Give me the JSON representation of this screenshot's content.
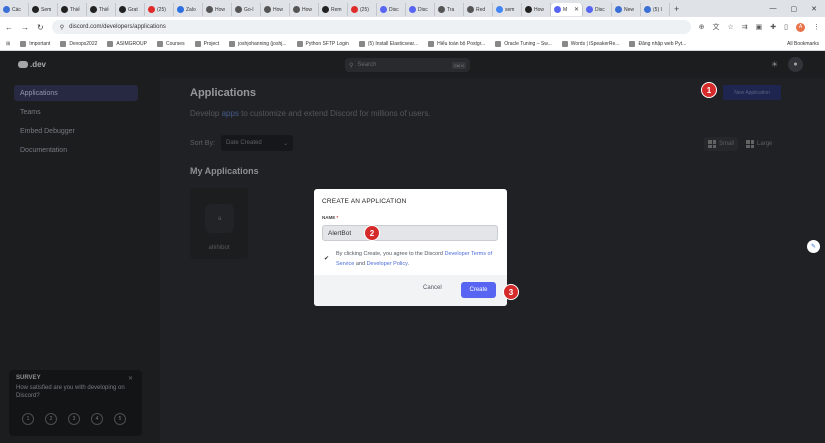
{
  "browser": {
    "tabs": [
      {
        "label": "Các",
        "color": "#3b6fd6"
      },
      {
        "label": "Sem",
        "color": "#222222"
      },
      {
        "label": "Thiế",
        "color": "#222222"
      },
      {
        "label": "Thiế",
        "color": "#222222"
      },
      {
        "label": "Grat",
        "color": "#222222"
      },
      {
        "label": "(25)",
        "color": "#e02b2b"
      },
      {
        "label": "Zalo",
        "color": "#2c6fe0"
      },
      {
        "label": "How",
        "color": "#555555"
      },
      {
        "label": "Go-l",
        "color": "#555555"
      },
      {
        "label": "How",
        "color": "#555555"
      },
      {
        "label": "How",
        "color": "#555555"
      },
      {
        "label": "Rem",
        "color": "#222222"
      },
      {
        "label": "(25)",
        "color": "#e02b2b"
      },
      {
        "label": "Disc",
        "color": "#5865f2"
      },
      {
        "label": "Disc",
        "color": "#5865f2"
      },
      {
        "label": "Tra",
        "color": "#555555"
      },
      {
        "label": "Red",
        "color": "#555555"
      },
      {
        "label": "sem",
        "color": "#4285f4"
      },
      {
        "label": "How",
        "color": "#222222"
      }
    ],
    "active_tab": {
      "label": "M",
      "color": "#5865f2"
    },
    "tabs_after": [
      {
        "label": "Disc",
        "color": "#5865f2"
      },
      {
        "label": "New",
        "color": "#3b6fd6"
      },
      {
        "label": "(5) I",
        "color": "#3b6fd6"
      }
    ],
    "url": "discord.com/developers/applications",
    "profile_initial": "A",
    "bookmarks": [
      "Important",
      "Devops2022",
      "ASIMGROUP",
      "Courses",
      "Project",
      "joshjohanning (joshj...",
      "Python SFTP Login",
      "(5) Install Elasticsear...",
      "Hiểu toàn bộ Postgr...",
      "Oracle Tuning – Sw...",
      "Words | iSpeakerRe...",
      "Đăng nhập web Pyt..."
    ],
    "bookmarks_right": "All Bookmarks"
  },
  "header": {
    "logo_text": ".dev",
    "search_placeholder": "Search",
    "search_shortcut": "Ctrl K"
  },
  "sidebar": {
    "items": [
      {
        "label": "Applications",
        "active": true
      },
      {
        "label": "Teams",
        "active": false
      },
      {
        "label": "Embed Debugger",
        "active": false
      },
      {
        "label": "Documentation",
        "active": false
      }
    ]
  },
  "main": {
    "title": "Applications",
    "subtitle_pre": "Develop ",
    "subtitle_link": "apps",
    "subtitle_post": " to customize and extend Discord for millions of users.",
    "new_app_button": "New Application",
    "sort_label": "Sort By:",
    "sort_value": "Date Created",
    "view_small": "Small",
    "view_large": "Large",
    "my_apps_title": "My Applications",
    "apps": [
      {
        "name": "ahihibot",
        "icon_text": "a"
      }
    ]
  },
  "survey": {
    "title": "SURVEY",
    "question": "How satisfied are you with developing on Discord?",
    "ratings": [
      "1",
      "2",
      "3",
      "4",
      "5"
    ]
  },
  "modal": {
    "title": "CREATE AN APPLICATION",
    "name_label": "NAME",
    "required_mark": "*",
    "name_value": "AlertBot",
    "agree_pre": "By clicking Create, you agree to the Discord ",
    "agree_link1": "Developer Terms of Service",
    "agree_mid": " and ",
    "agree_link2": "Developer Policy",
    "agree_post": ".",
    "cancel_label": "Cancel",
    "create_label": "Create"
  },
  "annotations": {
    "step1": "1",
    "step2": "2",
    "step3": "3"
  }
}
